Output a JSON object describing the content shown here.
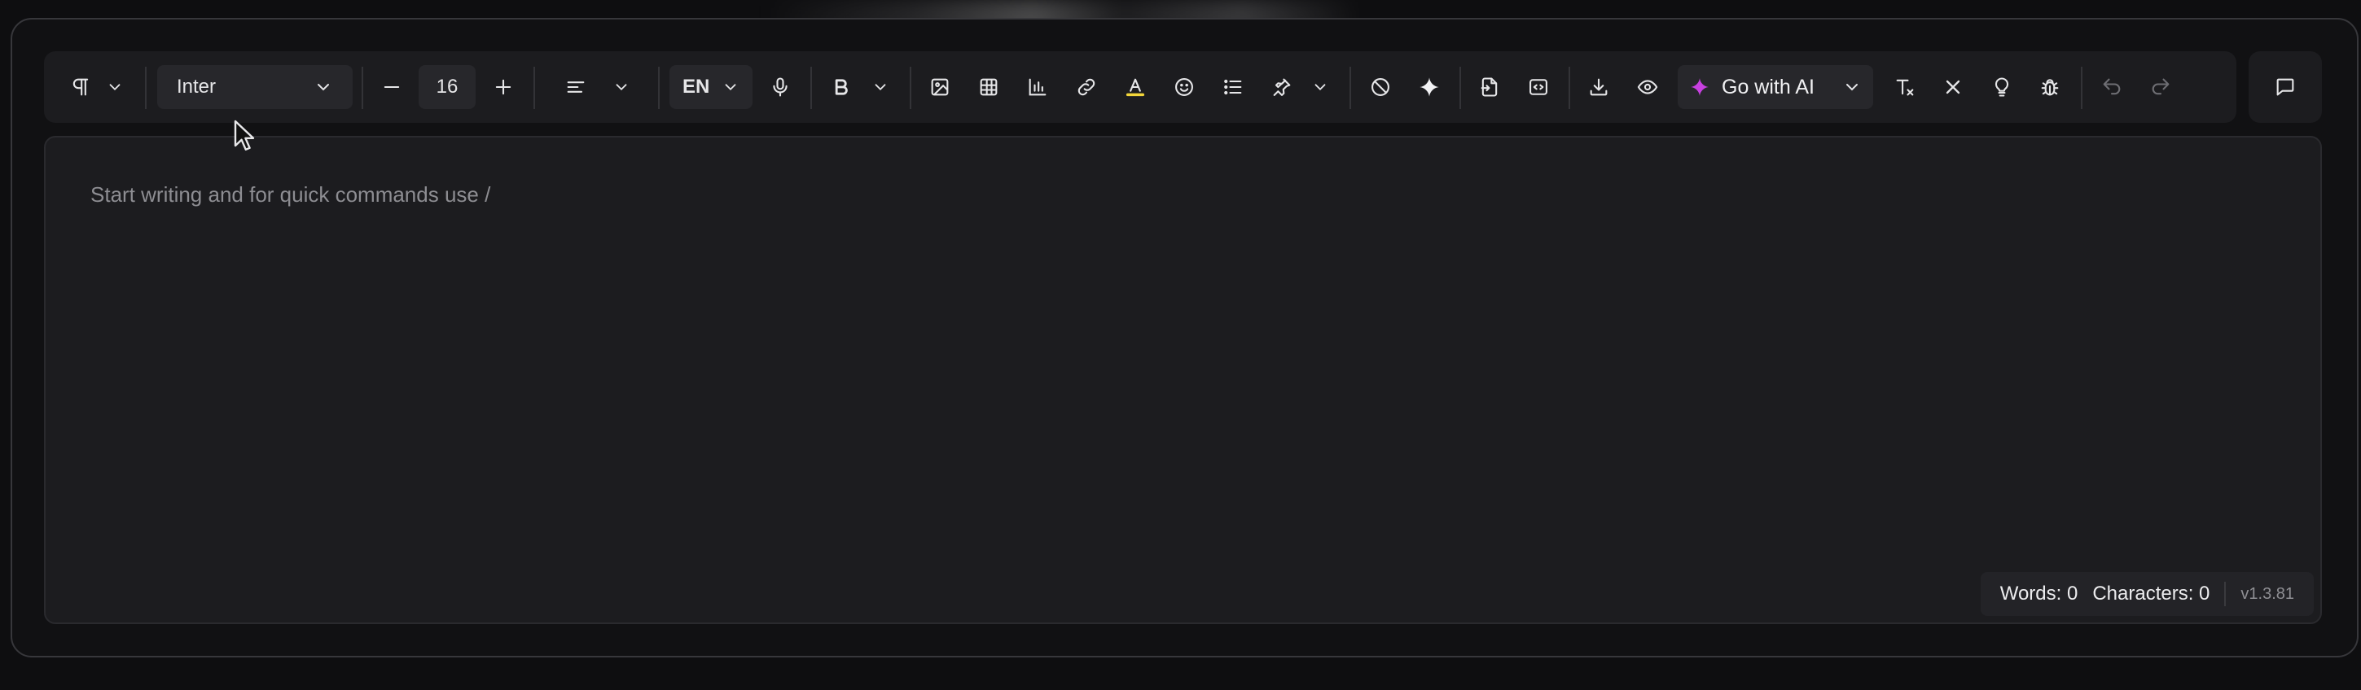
{
  "toolbar": {
    "paragraph_icon": "pilcrow-icon",
    "font_family": "Inter",
    "font_size": "16",
    "language": "EN",
    "ai_button_label": "Go with AI",
    "ai_accent": "#c840e0",
    "icons": [
      "pilcrow-icon",
      "minus-icon",
      "plus-icon",
      "align-left-icon",
      "microphone-icon",
      "bold-icon",
      "image-icon",
      "table-icon",
      "chart-icon",
      "link-icon",
      "text-color-icon",
      "emoji-icon",
      "list-icon",
      "pin-icon",
      "block-icon",
      "sparkle-icon",
      "import-icon",
      "code-icon",
      "download-icon",
      "eye-icon",
      "clear-format-icon",
      "close-icon",
      "bulb-icon",
      "bug-icon",
      "undo-icon",
      "redo-icon",
      "comment-icon"
    ],
    "text_color_underline": "#f2d53a"
  },
  "editor": {
    "placeholder": "Start writing and for quick commands use /"
  },
  "status": {
    "words": "Words: 0",
    "characters": "Characters: 0",
    "version": "v1.3.81"
  }
}
